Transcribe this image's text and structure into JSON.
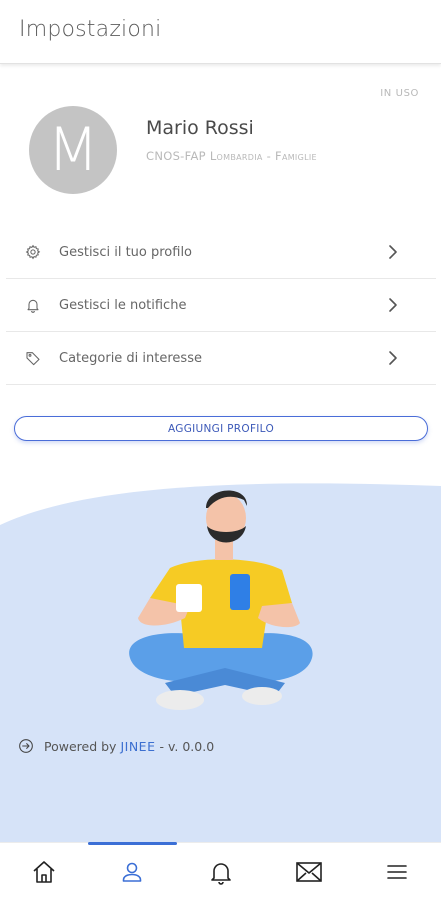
{
  "header": {
    "title": "Impostazioni"
  },
  "profile": {
    "status": "IN USO",
    "avatar_initial": "M",
    "name": "Mario Rossi",
    "organization": "CNOS-FAP Lombardia - Famiglie"
  },
  "menu": {
    "items": [
      {
        "label": "Gestisci il tuo profilo",
        "icon": "gear-icon"
      },
      {
        "label": "Gestisci le notifiche",
        "icon": "bell-icon"
      },
      {
        "label": "Categorie di interesse",
        "icon": "tag-icon"
      }
    ]
  },
  "actions": {
    "add_profile": "AGGIUNGI PROFILO"
  },
  "footer": {
    "powered_by": "Powered by",
    "brand": "JINEE",
    "version": "- v. 0.0.0"
  },
  "tabbar": {
    "tabs": [
      "home-icon",
      "profile-icon",
      "bell-icon",
      "mail-icon",
      "menu-icon"
    ],
    "active_index": 1
  },
  "colors": {
    "accent": "#3b6fd6",
    "blob": "#d6e3f8",
    "avatar": "#c4c4c4"
  }
}
